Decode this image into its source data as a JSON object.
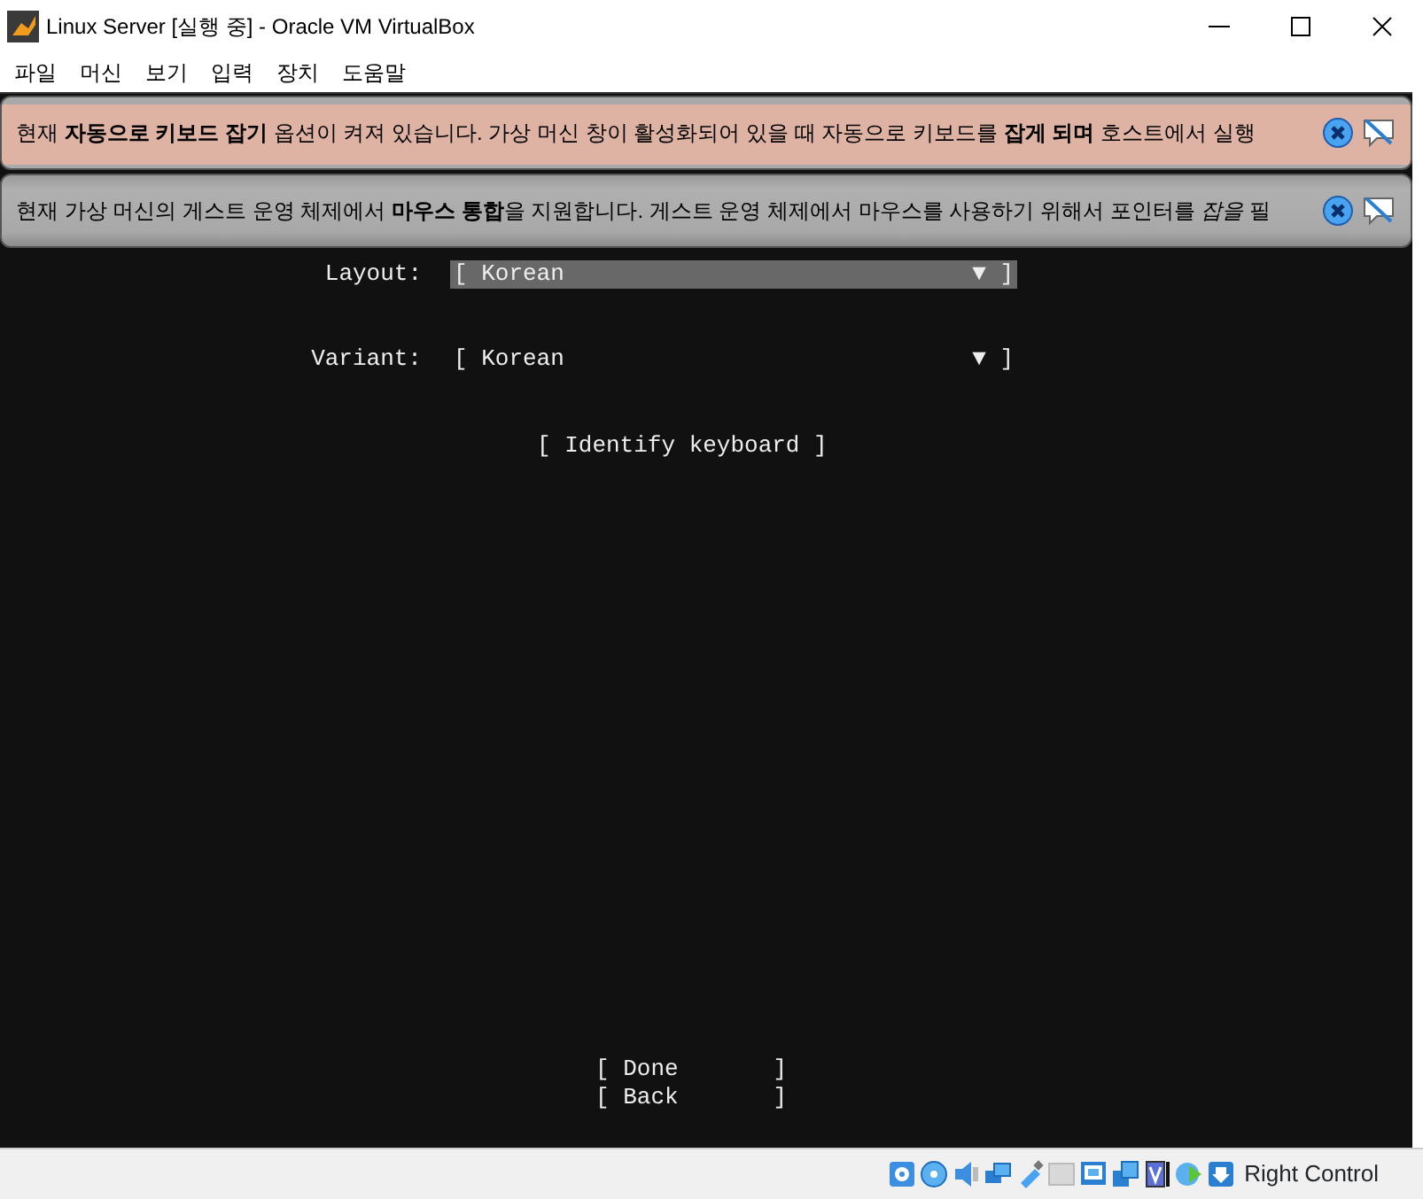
{
  "window": {
    "title": "Linux Server [실행 중] - Oracle VM VirtualBox"
  },
  "menu": [
    "파일",
    "머신",
    "보기",
    "입력",
    "장치",
    "도움말"
  ],
  "notifications": [
    {
      "kind": "warning",
      "text": "현재 **자동으로 키보드 잡기** 옵션이 켜져 있습니다. 가상 머신 창이 활성화되어 있을 때 자동으로 키보드를 **잡게 되며** 호스트에서 실행"
    },
    {
      "kind": "info",
      "text": "현재 가상 머신의 게스트 운영 체제에서 **마우스 통합**을 지원합니다. 게스트 운영 체제에서 마우스를 사용하기 위해서 포인터를 *잡을* 필"
    }
  ],
  "installer": {
    "fields": [
      {
        "label": "Layout:",
        "value": "[ Korean",
        "arrow": "▼ ]",
        "selected": true
      },
      {
        "label": "Variant:",
        "value": "[ Korean",
        "arrow": "▼ ]",
        "selected": false
      }
    ],
    "identify": "[ Identify keyboard ]",
    "buttons": [
      {
        "left": "[ Done",
        "right": "]"
      },
      {
        "left": "[ Back",
        "right": "]"
      }
    ]
  },
  "status_bar": {
    "host_key": "Right Control"
  }
}
